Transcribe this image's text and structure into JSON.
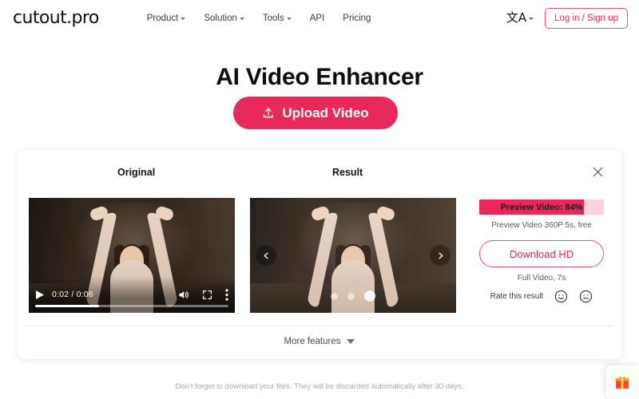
{
  "header": {
    "logo": "cutout.pro",
    "nav": [
      {
        "label": "Product",
        "has_caret": true
      },
      {
        "label": "Solution",
        "has_caret": true
      },
      {
        "label": "Tools",
        "has_caret": true
      },
      {
        "label": "API",
        "has_caret": false
      },
      {
        "label": "Pricing",
        "has_caret": false
      }
    ],
    "language_glyph": "文A",
    "login_label": "Log in / Sign up"
  },
  "hero": {
    "title": "AI Video Enhancer",
    "upload_label": "Upload Video"
  },
  "card": {
    "original_label": "Original",
    "result_label": "Result",
    "player": {
      "time": "0:02 / 0:06",
      "progress_percent": 33
    },
    "carousel": {
      "dots_count": 3,
      "active_dot": 3
    },
    "actions": {
      "progress_label": "Preview Video: 84%",
      "progress_percent": 84,
      "preview_note": "Preview Video 360P 5s, free",
      "download_label": "Download HD",
      "full_note": "Full Video, 7s",
      "rate_text": "Rate this result"
    },
    "more_features_label": "More features"
  },
  "footer": {
    "note": "Don't forget to download your files. They will be discarded automatically after 30 days."
  },
  "colors": {
    "accent": "#e8275a",
    "accent_border": "#e9517d",
    "progress_track": "#fad3de",
    "text_dark": "#0d0d0d",
    "text_muted": "#5a5a5a",
    "footer_text": "#a9a9a9"
  }
}
